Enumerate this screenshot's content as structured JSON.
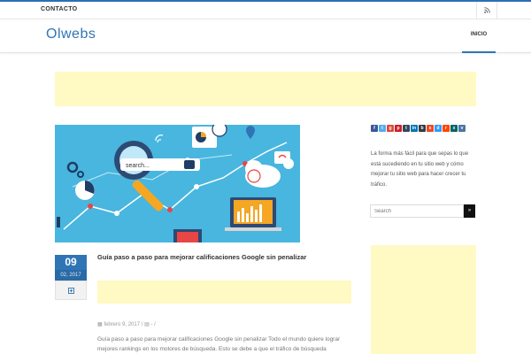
{
  "topbar": {
    "contact": "CONTACTO",
    "rss_icon": "rss-icon"
  },
  "header": {
    "logo": "Olwebs",
    "nav_home": "INICIO"
  },
  "post": {
    "image_alt_labels": {
      "search_box": "search..."
    },
    "date_day": "09",
    "date_month": "02, 2017",
    "title": "Guía paso a paso para mejorar calificaciones Google sin penalizar",
    "meta_date": "febrero 9, 2017",
    "meta_sep1": "/",
    "meta_dash": "-",
    "meta_sep2": "/",
    "excerpt": "Guía paso a paso para mejorar calificaciones Google sin penalizar Todo el mundo quiere lograr mejores rankings en los motores de búsqueda. Esto se debe a que el tráfico de búsqueda"
  },
  "sidebar": {
    "social": [
      {
        "icon": "facebook-icon",
        "glyph": "f",
        "color": "#3b5998"
      },
      {
        "icon": "twitter-icon",
        "glyph": "t",
        "color": "#55acee"
      },
      {
        "icon": "google-plus-icon",
        "glyph": "g",
        "color": "#dd4b39"
      },
      {
        "icon": "pinterest-icon",
        "glyph": "p",
        "color": "#cb2027"
      },
      {
        "icon": "tumblr-icon",
        "glyph": "t",
        "color": "#35465c"
      },
      {
        "icon": "linkedin-icon",
        "glyph": "in",
        "color": "#0077b5"
      },
      {
        "icon": "buffer-icon",
        "glyph": "b",
        "color": "#323b43"
      },
      {
        "icon": "stumbleupon-icon",
        "glyph": "s",
        "color": "#eb4924"
      },
      {
        "icon": "delicious-icon",
        "glyph": "d",
        "color": "#3399ff"
      },
      {
        "icon": "reddit-icon",
        "glyph": "r",
        "color": "#ff4500"
      },
      {
        "icon": "xing-icon",
        "glyph": "x",
        "color": "#026466"
      },
      {
        "icon": "vk-icon",
        "glyph": "v",
        "color": "#4c75a3"
      }
    ],
    "text": "La forma más fácil para que sepas lo que está sucediendo en tu sitio web y cómo mejorar tu sitio web para hacer crecer tu tráfico.",
    "search_placeholder": "Search",
    "search_button": "»"
  },
  "colors": {
    "accent": "#2f74b5",
    "ad_bg": "#fff9c4",
    "image_bg": "#4ab8e0"
  }
}
